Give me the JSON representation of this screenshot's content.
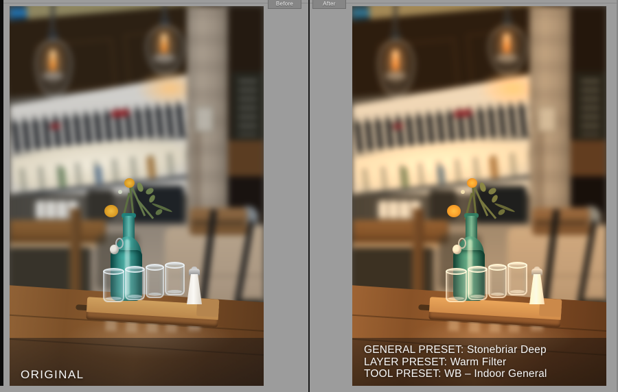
{
  "colors": {
    "canvas": "#9c9c9c",
    "tab_gray": "#868686",
    "divider": "#191919",
    "caption_text": "#f7f7f7"
  },
  "toolbar": {
    "before_tab": "Before",
    "after_tab": "After"
  },
  "before_panel": {
    "label": "ORIGINAL"
  },
  "after_panel": {
    "presets": [
      {
        "label": "GENERAL PRESET:",
        "value": "Stonebriar Deep"
      },
      {
        "label": "LAYER PRESET:",
        "value": "Warm Filter"
      },
      {
        "label": "TOOL PRESET:",
        "value": "WB – Indoor General"
      }
    ]
  }
}
